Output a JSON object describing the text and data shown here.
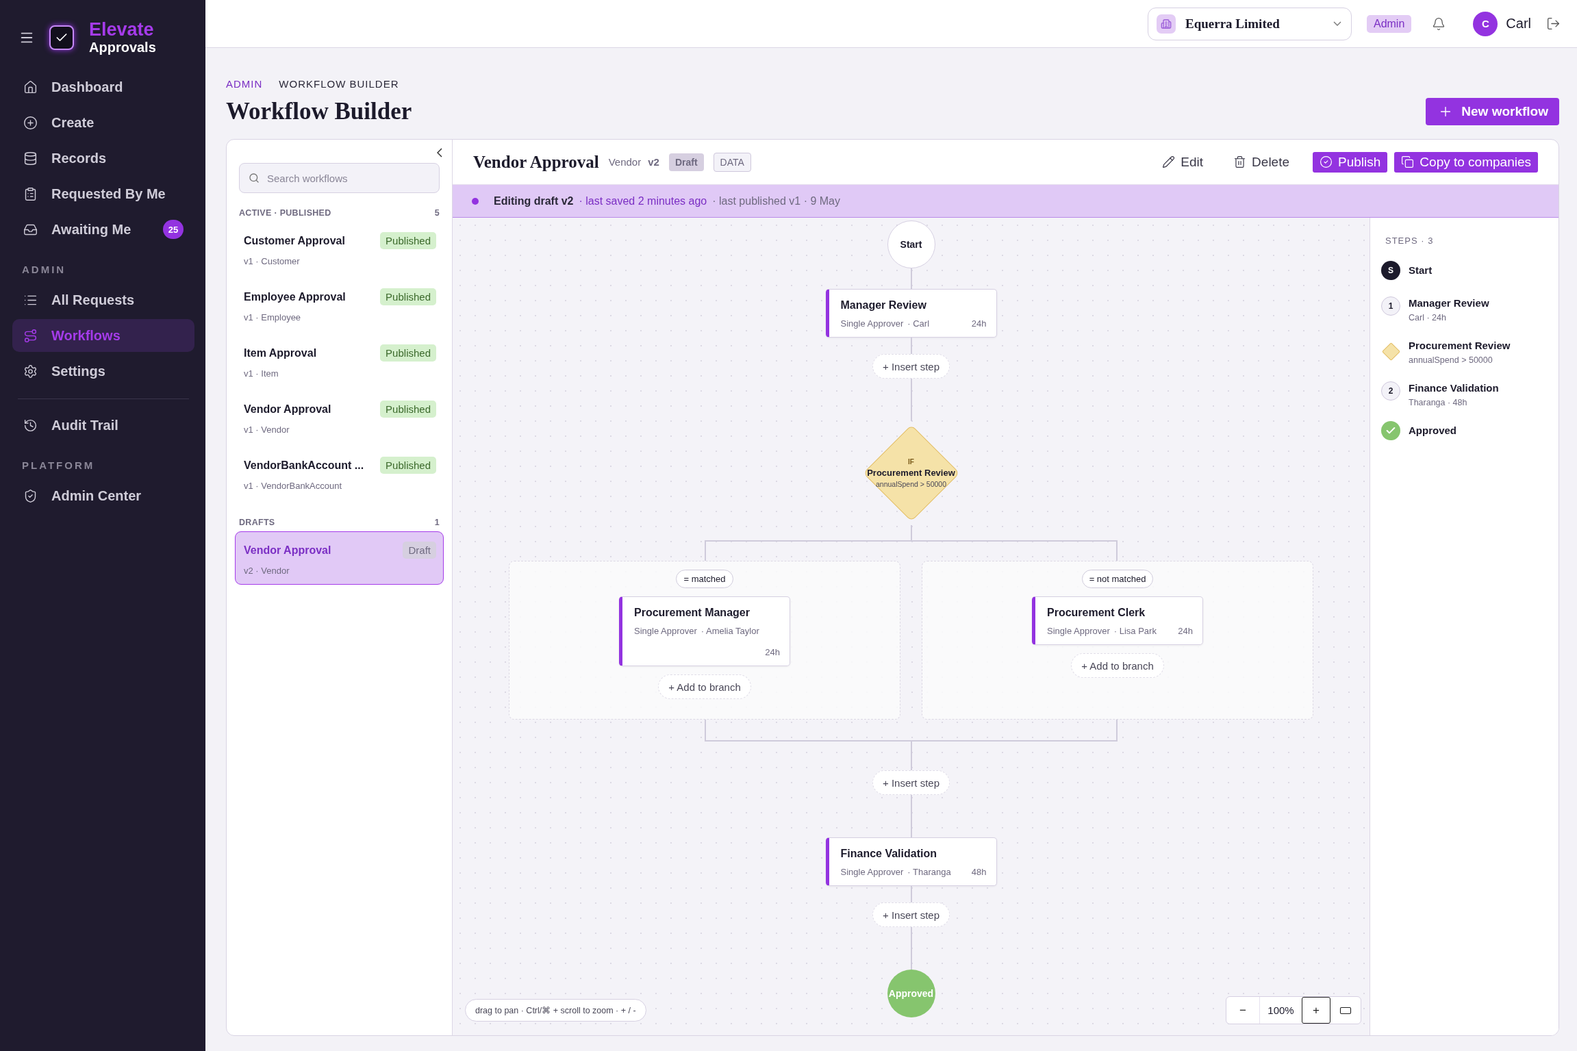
{
  "sidebar": {
    "brand": {
      "name": "Elevate",
      "subtitle": "Approvals"
    },
    "groups": [
      {
        "items": [
          {
            "label": "Dashboard",
            "selected": false
          },
          {
            "label": "Create",
            "selected": false
          },
          {
            "label": "Records",
            "selected": false
          },
          {
            "label": "Requested By Me",
            "selected": false
          },
          {
            "label": "Awaiting Me",
            "selected": false,
            "badge": "25"
          }
        ]
      },
      {
        "heading": "ADMIN",
        "items": [
          {
            "label": "All Requests",
            "selected": false
          },
          {
            "label": "Workflows",
            "selected": true
          },
          {
            "label": "Settings",
            "selected": false
          }
        ]
      },
      {
        "divider": true,
        "items": [
          {
            "label": "Audit Trail",
            "selected": false
          }
        ]
      },
      {
        "heading": "PLATFORM",
        "items": [
          {
            "label": "Admin Center",
            "selected": false
          }
        ]
      }
    ]
  },
  "topbar": {
    "company": "Equerra Limited",
    "role": "Admin",
    "user_initial": "C",
    "user_name": "Carl"
  },
  "page": {
    "breadcrumb": [
      "ADMIN",
      "WORKFLOW BUILDER"
    ],
    "title": "Workflow Builder",
    "new_button": "New workflow"
  },
  "workflow_list": {
    "search": {
      "placeholder": "Search workflows"
    },
    "sections": [
      {
        "heading": "ACTIVE · PUBLISHED",
        "count": "5",
        "items": [
          {
            "name": "Customer Approval",
            "meta": "v1 · Customer",
            "status": "Published",
            "kind": "published",
            "selected": false
          },
          {
            "name": "Employee Approval",
            "meta": "v1 · Employee",
            "status": "Published",
            "kind": "published",
            "selected": false
          },
          {
            "name": "Item Approval",
            "meta": "v1 · Item",
            "status": "Published",
            "kind": "published",
            "selected": false
          },
          {
            "name": "Vendor Approval",
            "meta": "v1 · Vendor",
            "status": "Published",
            "kind": "published",
            "selected": false
          },
          {
            "name": "VendorBankAccount ...",
            "meta": "v1 · VendorBankAccount",
            "status": "Published",
            "kind": "published",
            "selected": false
          }
        ]
      },
      {
        "heading": "DRAFTS",
        "count": "1",
        "items": [
          {
            "name": "Vendor Approval",
            "meta": "v2 · Vendor",
            "status": "Draft",
            "kind": "draft",
            "selected": true
          }
        ]
      }
    ]
  },
  "editor": {
    "title": "Vendor Approval",
    "entity": "Vendor",
    "version": "v2",
    "badges": [
      {
        "label": "Draft",
        "kind": "draft"
      },
      {
        "label": "DATA",
        "kind": "outline"
      }
    ],
    "actions": [
      {
        "label": "Edit",
        "kind": "ghost"
      },
      {
        "label": "Delete",
        "kind": "ghost"
      },
      {
        "label": "Publish",
        "kind": "primary"
      },
      {
        "label": "Copy to companies",
        "kind": "primary"
      }
    ],
    "banner": {
      "lead": "Editing draft v2",
      "saved": "· last saved 2 minutes ago",
      "published": "· last published v1 · 9 May"
    }
  },
  "flow": [
    {
      "kind": "start",
      "label": "Start"
    },
    {
      "kind": "step",
      "title": "Manager Review",
      "type": "Single Approver",
      "approver": "· Carl",
      "sla": "24h"
    },
    {
      "kind": "insert",
      "label": "+ Insert step"
    },
    {
      "kind": "condition",
      "label": "IF",
      "title": "Procurement Review",
      "rule": "annualSpend > 50000"
    },
    {
      "kind": "branches",
      "branches": [
        {
          "label": "= matched",
          "steps": [
            {
              "title": "Procurement Manager",
              "type": "Single Approver",
              "approver": "· Amelia Taylor",
              "sla": "24h"
            }
          ],
          "add": "+ Add to branch"
        },
        {
          "label": "= not matched",
          "steps": [
            {
              "title": "Procurement Clerk",
              "type": "Single Approver",
              "approver": "· Lisa Park",
              "sla": "24h"
            }
          ],
          "add": "+ Add to branch"
        }
      ]
    },
    {
      "kind": "insert",
      "label": "+ Insert step"
    },
    {
      "kind": "step",
      "title": "Finance Validation",
      "type": "Single Approver",
      "approver": "· Tharanga",
      "sla": "48h"
    },
    {
      "kind": "insert",
      "label": "+ Insert step"
    },
    {
      "kind": "end",
      "label": "Approved"
    }
  ],
  "canvas_hint": "drag to pan · Ctrl/⌘ + scroll to zoom · + / -",
  "zoom": {
    "minus": "−",
    "value": "100%",
    "plus": "+"
  },
  "steps_panel": {
    "heading": "STEPS · 3",
    "items": [
      {
        "kind": "start",
        "badge": "S",
        "title": "Start"
      },
      {
        "kind": "step",
        "badge": "1",
        "title": "Manager Review",
        "detail": "Carl · 24h"
      },
      {
        "kind": "condition",
        "title": "Procurement Review",
        "detail": "annualSpend > 50000"
      },
      {
        "kind": "step",
        "badge": "2",
        "title": "Finance Validation",
        "detail": "Tharanga · 48h"
      },
      {
        "kind": "end",
        "title": "Approved"
      }
    ]
  }
}
